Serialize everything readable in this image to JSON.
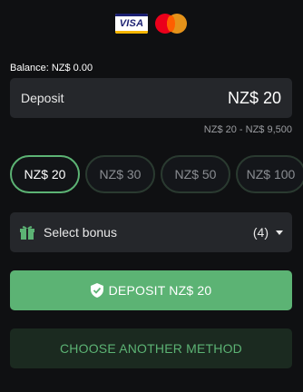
{
  "payment_logos": {
    "visa_text": "VISA",
    "icons": [
      "visa-card-icon",
      "mastercard-icon"
    ]
  },
  "balance": {
    "label": "Balance:",
    "amount": "NZ$ 0.00"
  },
  "deposit": {
    "label": "Deposit",
    "value": "NZ$ 20",
    "range": "NZ$ 20 - NZ$ 9,500"
  },
  "amount_chips": [
    {
      "label": "NZ$ 20",
      "selected": true
    },
    {
      "label": "NZ$ 30",
      "selected": false
    },
    {
      "label": "NZ$ 50",
      "selected": false
    },
    {
      "label": "NZ$ 100",
      "selected": false
    }
  ],
  "bonus": {
    "label": "Select bonus",
    "count": "(4)",
    "icon": "gift-icon"
  },
  "actions": {
    "deposit_label": "DEPOSIT NZ$ 20",
    "deposit_icon": "shield-check-icon",
    "other_method_label": "CHOOSE ANOTHER METHOD"
  },
  "colors": {
    "background": "#0f1012",
    "panel": "#25272b",
    "accent_green": "#5cb374",
    "dark_green_button": "#1b2a20"
  }
}
